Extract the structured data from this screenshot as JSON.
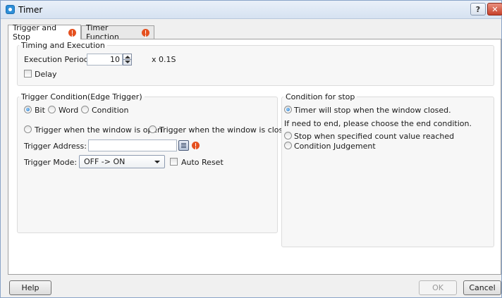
{
  "window": {
    "title": "Timer",
    "help_glyph": "?",
    "close_glyph": "✕"
  },
  "tabs": [
    {
      "label": "Trigger and Stop",
      "icon": "warning-icon"
    },
    {
      "label": "Timer Function",
      "icon": "warning-icon"
    }
  ],
  "timing": {
    "legend": "Timing and Execution",
    "execution_period_label": "Execution Period:",
    "execution_period_value": "10",
    "unit": "x 0.1S",
    "delay_label": "Delay",
    "delay_checked": false
  },
  "trigger": {
    "legend": "Trigger Condition(Edge Trigger)",
    "types": [
      {
        "label": "Bit",
        "selected": true
      },
      {
        "label": "Word",
        "selected": false
      },
      {
        "label": "Condition",
        "selected": false
      }
    ],
    "window_options": [
      {
        "label": "Trigger when the window is open",
        "selected": false
      },
      {
        "label": "Trigger when the window is closed",
        "selected": false
      }
    ],
    "address_label": "Trigger Address:",
    "address_value": "",
    "mode_label": "Trigger Mode:",
    "mode_value": "OFF -> ON",
    "auto_reset_label": "Auto Reset",
    "auto_reset_checked": false
  },
  "stop": {
    "legend": "Condition for stop",
    "timer_stop_label": "Timer will stop when the window closed.",
    "timer_stop_selected": true,
    "hint": "If need to end, please choose the end condition.",
    "count_label": "Stop when specified count value reached",
    "judgement_label": "Condition Judgement"
  },
  "buttons": {
    "help": "Help",
    "ok": "OK",
    "cancel": "Cancel"
  },
  "colors": {
    "accent": "#2e8fd8",
    "warning": "#e5501f"
  }
}
